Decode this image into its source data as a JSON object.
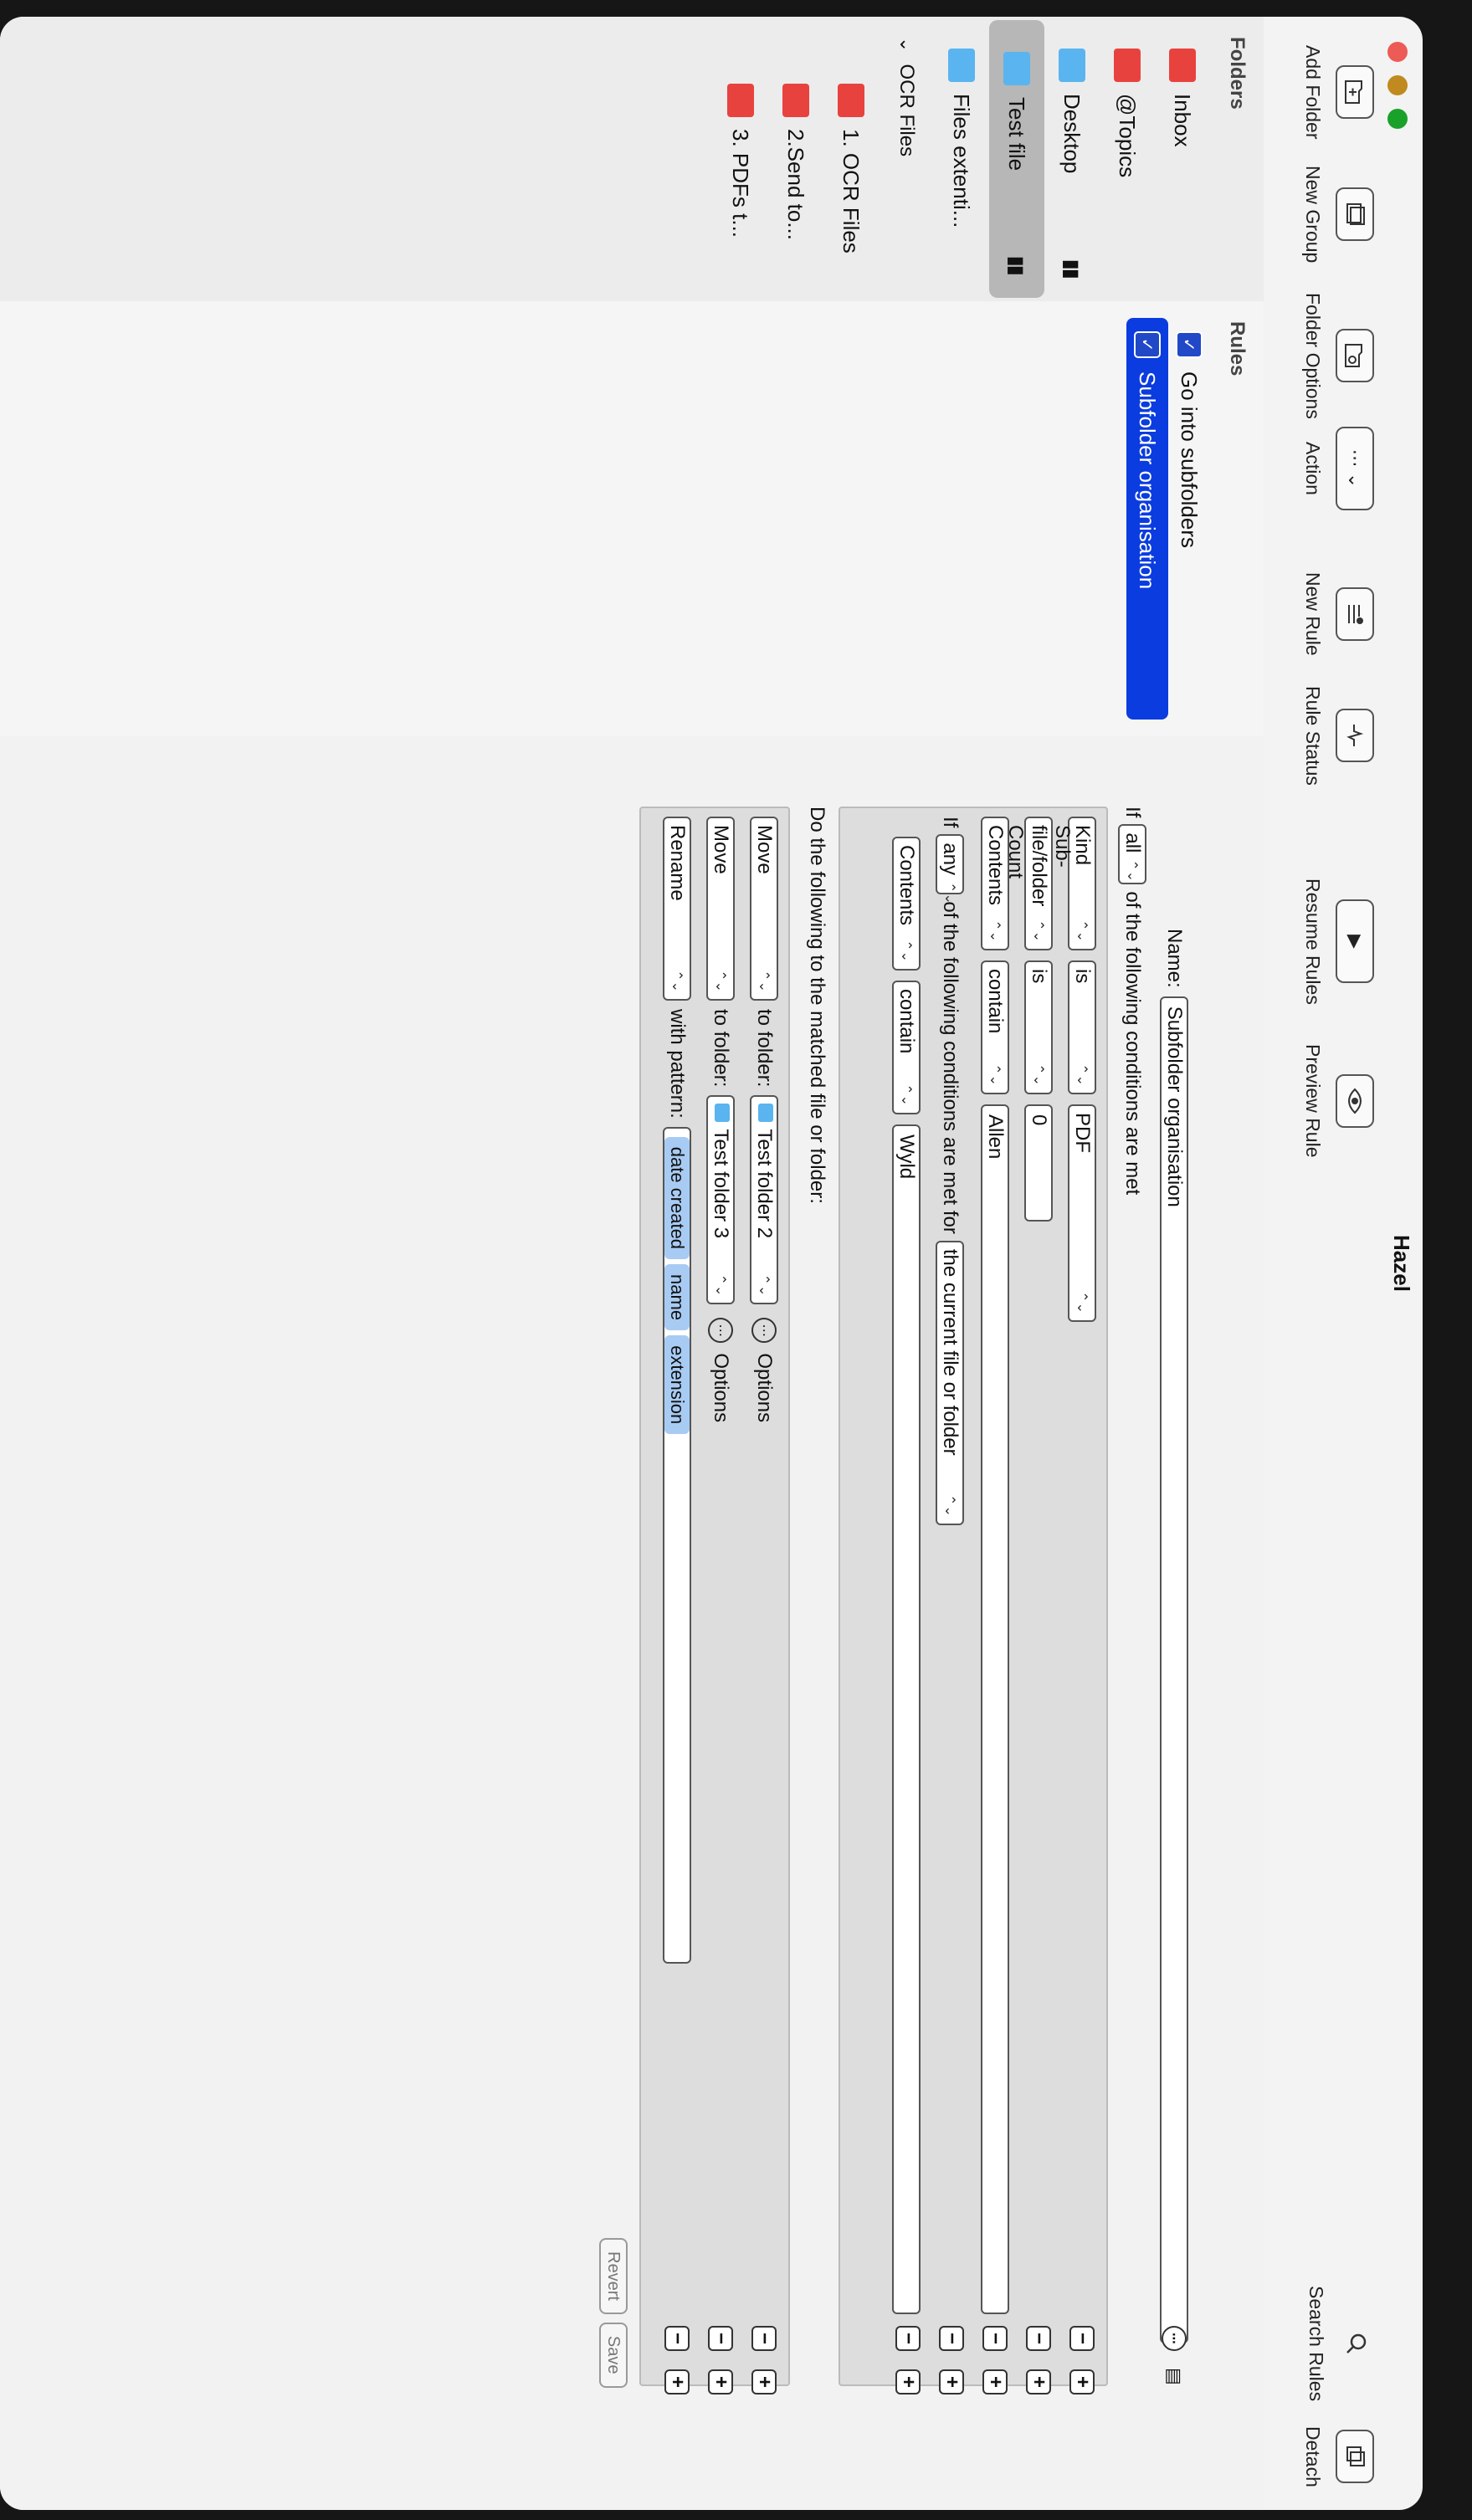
{
  "window": {
    "title": "Hazel"
  },
  "toolbar": {
    "add_folder": "Add Folder",
    "new_group": "New Group",
    "folder_options": "Folder Options",
    "action": "Action",
    "new_rule": "New Rule",
    "rule_status": "Rule Status",
    "resume_rules": "Resume Rules",
    "preview_rule": "Preview Rule",
    "search_rules": "Search Rules",
    "detach": "Detach"
  },
  "sidebar": {
    "header": "Folders",
    "items": [
      {
        "label": "Inbox",
        "color": "#e8423f"
      },
      {
        "label": "@Topics",
        "color": "#e8423f"
      },
      {
        "label": "Desktop",
        "color": "#5ab4ef"
      },
      {
        "label": "Test file",
        "color": "#5ab4ef"
      },
      {
        "label": "Files extenti...",
        "color": "#5ab4ef"
      }
    ],
    "group": {
      "label": "OCR Files"
    },
    "group_items": [
      {
        "label": "1. OCR Files",
        "color": "#e8423f"
      },
      {
        "label": "2.Send to...",
        "color": "#e8423f"
      },
      {
        "label": "3. PDFs t...",
        "color": "#e8423f"
      }
    ]
  },
  "rules": {
    "header": "Rules",
    "items": [
      {
        "label": "Go into subfolders"
      },
      {
        "label": "Subfolder organisation"
      }
    ]
  },
  "editor": {
    "name_label": "Name:",
    "name_value": "Subfolder organisation",
    "if_label": "If",
    "match_value": "all",
    "conditions_text": "of the following conditions are met",
    "conditions": [
      {
        "attribute": "Kind",
        "operator": "is",
        "value": "PDF"
      },
      {
        "attribute": "Sub-file/folder Count",
        "operator": "is",
        "value": "0"
      },
      {
        "attribute": "Contents",
        "operator": "contain",
        "value": "Allen"
      }
    ],
    "nested": {
      "if_label": "If",
      "match_value": "any",
      "text": "of the following conditions are met for",
      "target": "the current file or folder",
      "condition": {
        "attribute": "Contents",
        "operator": "contain",
        "value": "Wyld"
      }
    },
    "actions_label": "Do the following to the matched file or folder:",
    "actions": [
      {
        "verb": "Move",
        "prep": "to folder:",
        "target": "Test folder 2",
        "options": "Options"
      },
      {
        "verb": "Move",
        "prep": "to folder:",
        "target": "Test folder 3",
        "options": "Options"
      },
      {
        "verb": "Rename",
        "prep": "with pattern:",
        "tokens": [
          "date created",
          "name",
          "extension"
        ]
      }
    ],
    "revert": "Revert",
    "save": "Save"
  }
}
